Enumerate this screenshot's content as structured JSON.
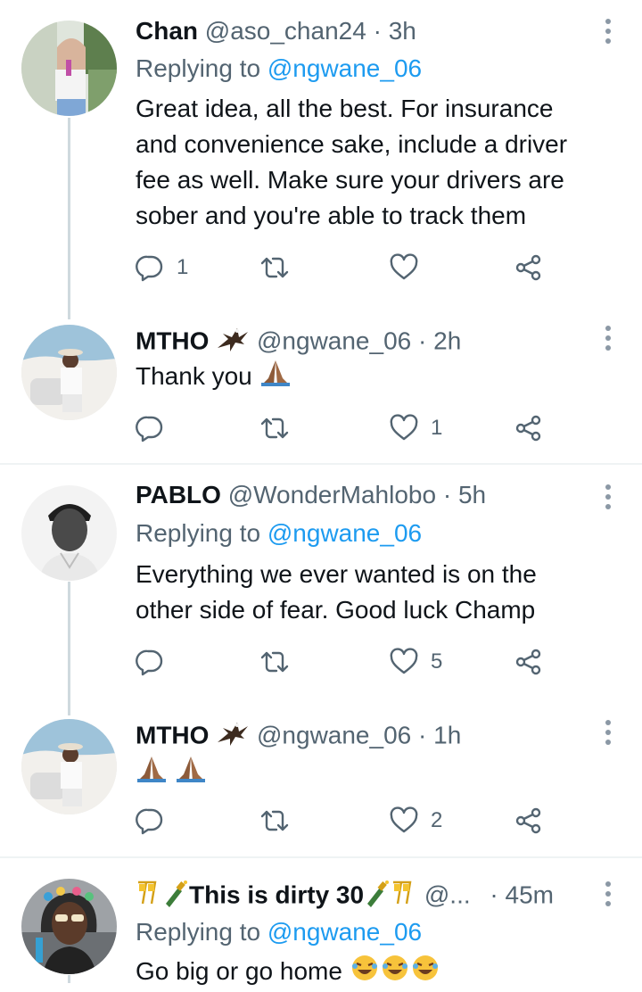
{
  "colors": {
    "accent": "#1d9bf0",
    "muted": "#536471",
    "text": "#0f1419",
    "line": "#cfd9de"
  },
  "tweets": [
    {
      "name": "Chan",
      "handle": "@aso_chan24",
      "dot": "·",
      "time": "3h",
      "replying_prefix": "Replying to",
      "replying_to": "@ngwane_06",
      "text_lines": [
        "Great idea, all the best. For insurance",
        "and convenience sake, include a driver",
        "fee as well. Make sure your drivers are",
        "sober and you're able to track them"
      ],
      "reply_count": "1",
      "retweet_count": "",
      "like_count": ""
    },
    {
      "name": "MTHO",
      "handle": "@ngwane_06",
      "dot": "·",
      "time": "2h",
      "text": "Thank you",
      "reply_count": "",
      "retweet_count": "",
      "like_count": "1"
    },
    {
      "name": "PABLO",
      "handle": "@WonderMahlobo",
      "dot": "·",
      "time": "5h",
      "replying_prefix": "Replying to",
      "replying_to": "@ngwane_06",
      "text_lines": [
        "Everything we ever wanted is on the",
        "other side of fear. Good luck Champ"
      ],
      "reply_count": "",
      "retweet_count": "",
      "like_count": "5"
    },
    {
      "name": "MTHO",
      "handle": "@ngwane_06",
      "dot": "·",
      "time": "1h",
      "text": "",
      "reply_count": "",
      "retweet_count": "",
      "like_count": "2"
    },
    {
      "name": "This is dirty 30",
      "handle": "@...",
      "dot": "·",
      "time": "45m",
      "replying_prefix": "Replying to",
      "replying_to": "@ngwane_06",
      "text": "Go big or go home"
    }
  ]
}
